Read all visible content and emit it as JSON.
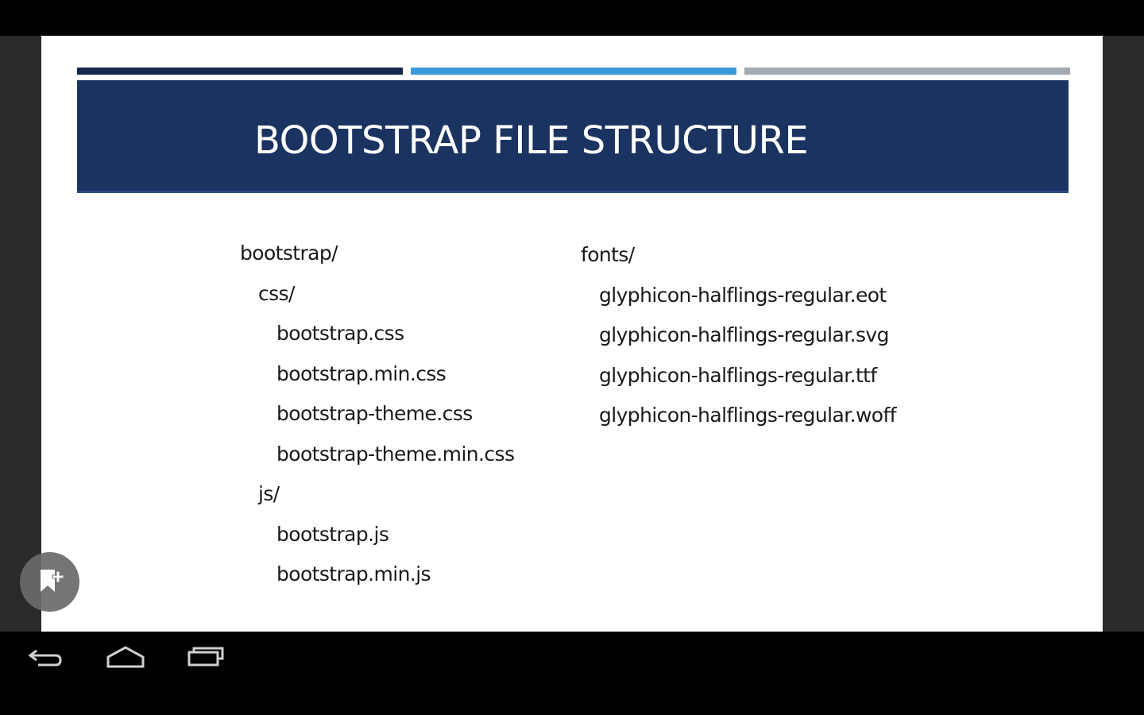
{
  "slide": {
    "title": "BOOTSTRAP FILE STRUCTURE",
    "left_tree": [
      {
        "text": "bootstrap/",
        "indent": 0
      },
      {
        "text": "css/",
        "indent": 1
      },
      {
        "text": "bootstrap.css",
        "indent": 2
      },
      {
        "text": "bootstrap.min.css",
        "indent": 2
      },
      {
        "text": "bootstrap-theme.css",
        "indent": 2
      },
      {
        "text": "bootstrap-theme.min.css",
        "indent": 2
      },
      {
        "text": "js/",
        "indent": 1
      },
      {
        "text": "bootstrap.js",
        "indent": 2
      },
      {
        "text": "bootstrap.min.js",
        "indent": 2
      }
    ],
    "right_tree": [
      {
        "text": "fonts/",
        "indent": 0
      },
      {
        "text": "glyphicon-halflings-regular.eot",
        "indent": 1
      },
      {
        "text": "glyphicon-halflings-regular.svg",
        "indent": 1
      },
      {
        "text": "glyphicon-halflings-regular.ttf",
        "indent": 1
      },
      {
        "text": "glyphicon-halflings-regular.woff",
        "indent": 1
      }
    ],
    "colors": {
      "banner": "#1b3360",
      "accent_dark": "#15294f",
      "accent_blue": "#3a9ad9",
      "accent_gray": "#a3a9ae"
    }
  },
  "overlay": {
    "bookmark_button_icon": "bookmark-add-icon"
  },
  "navigation": {
    "back_icon": "back-arrow-icon",
    "home_icon": "home-icon",
    "recents_icon": "recent-apps-icon"
  }
}
